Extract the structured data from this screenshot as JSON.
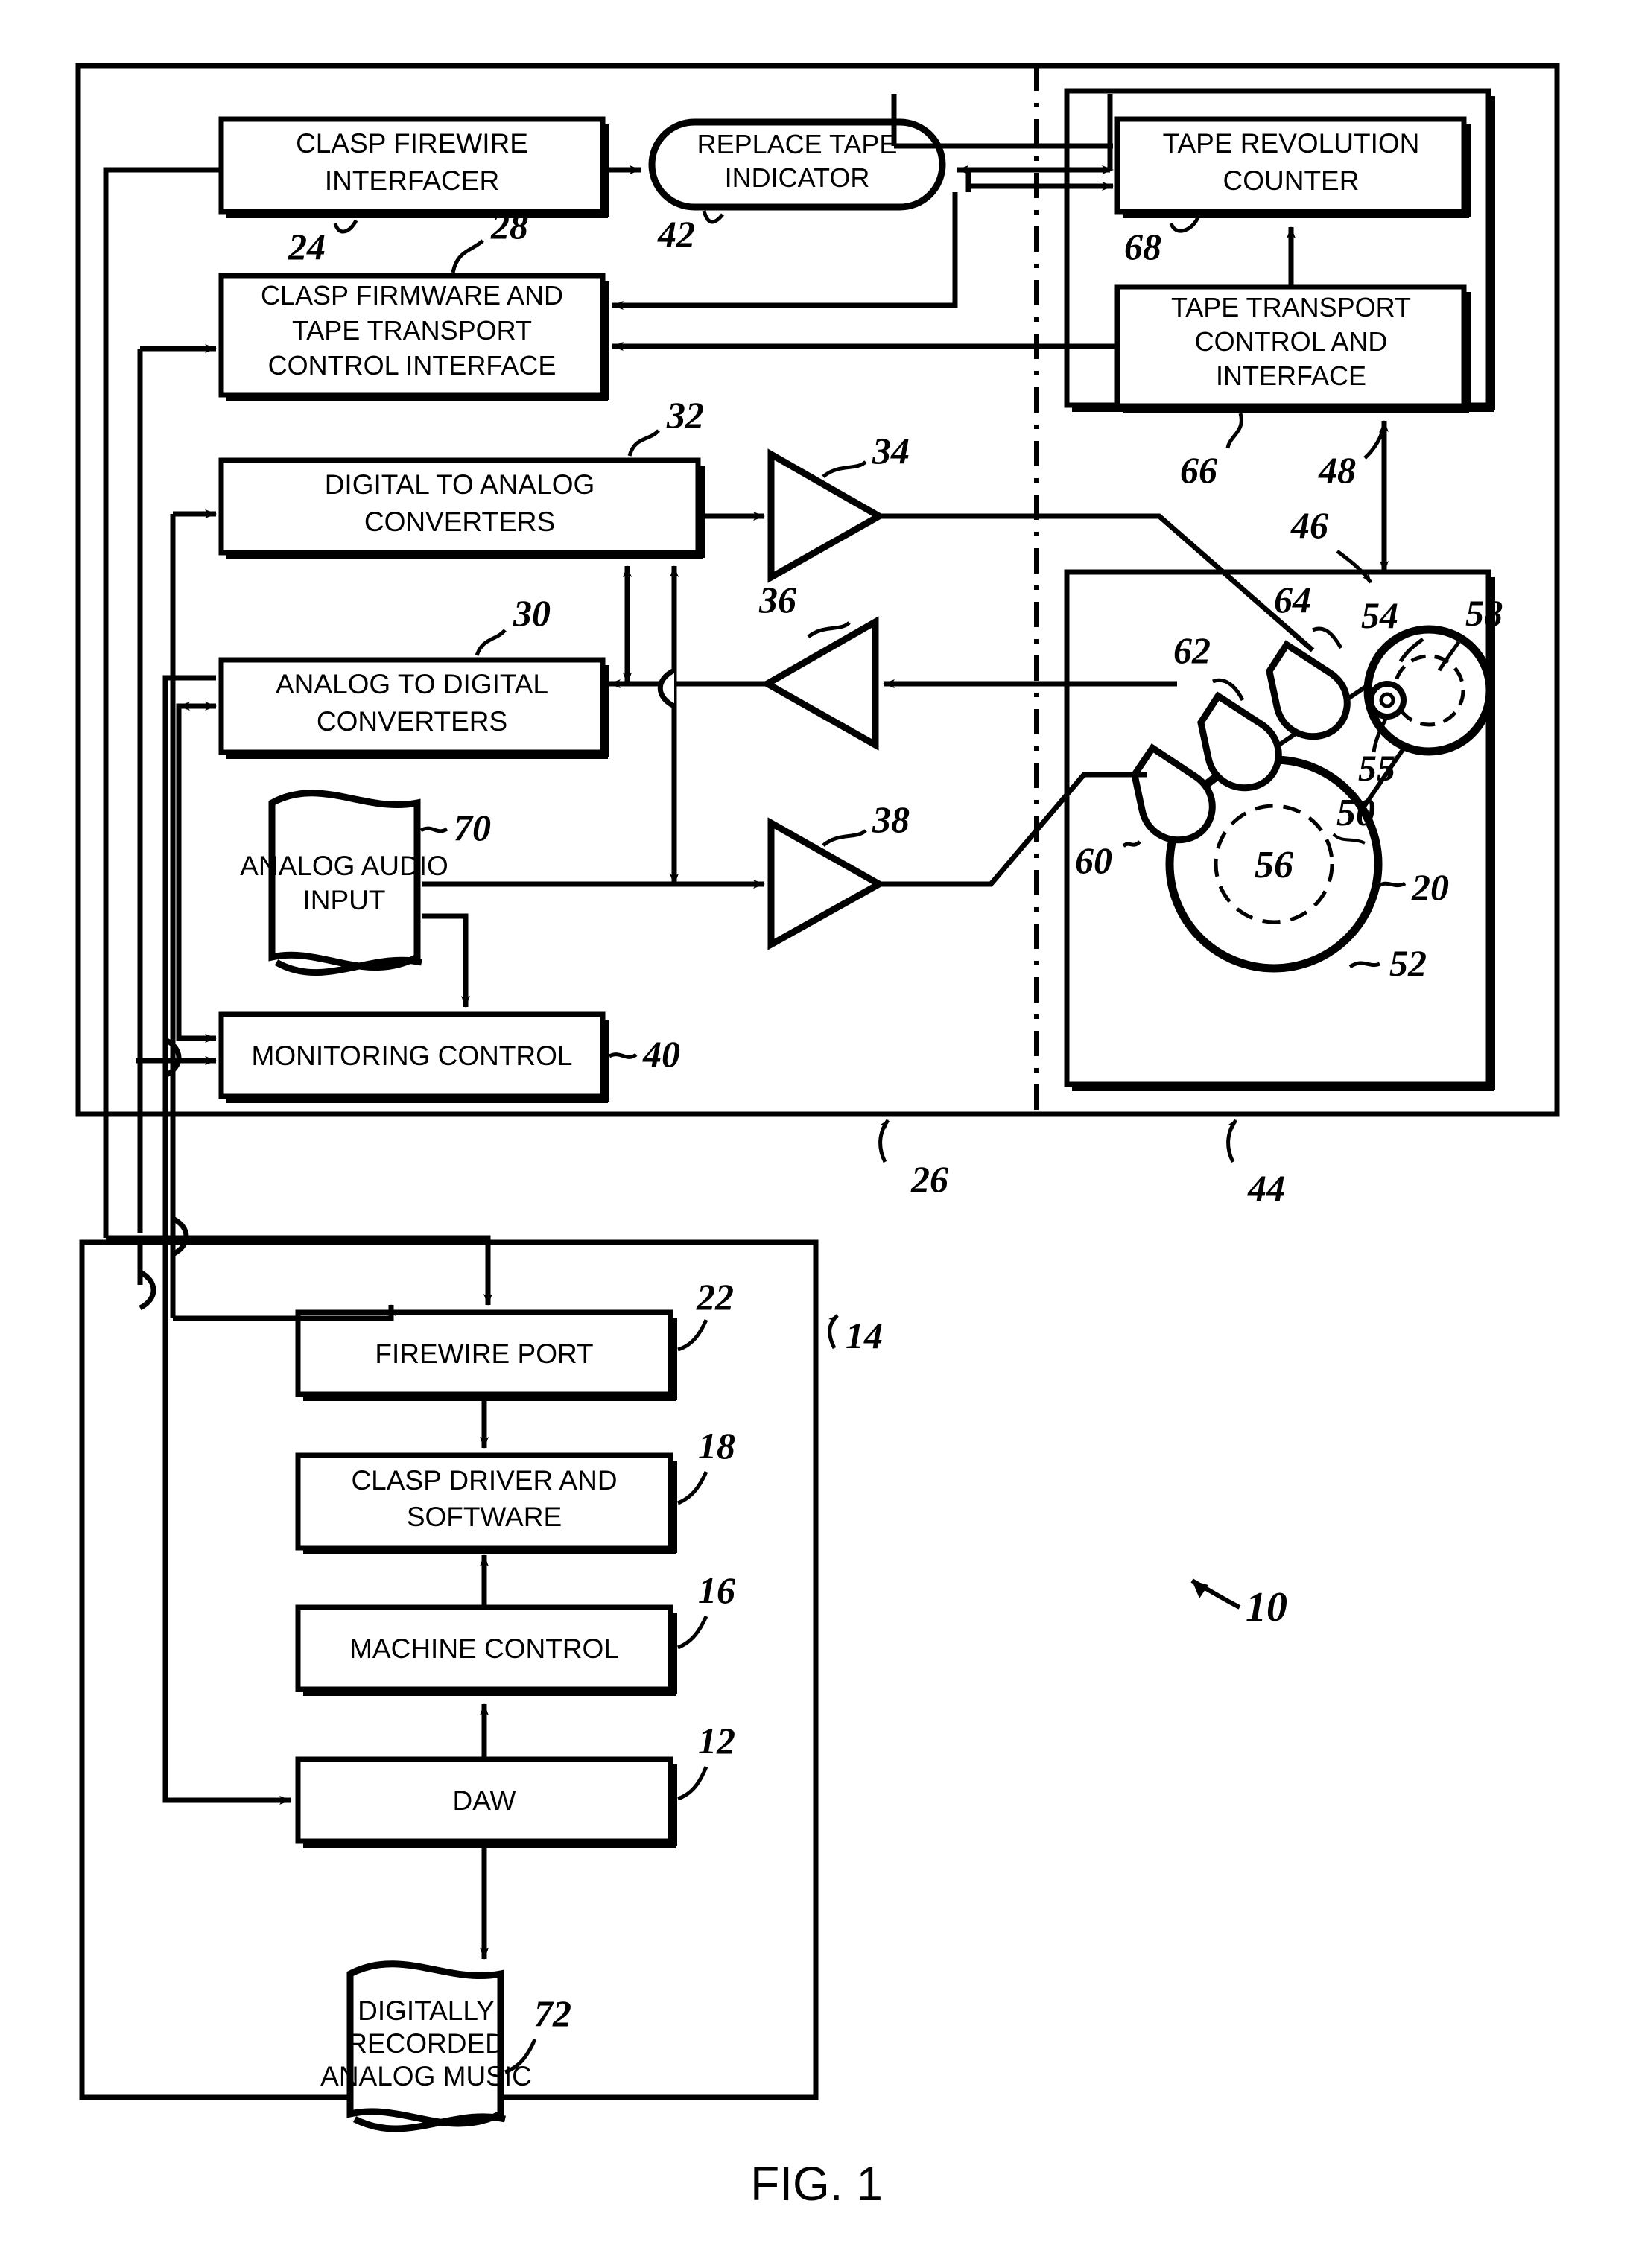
{
  "figure": {
    "caption": "FIG. 1",
    "title_number": "10"
  },
  "blocks": {
    "clasp_firewire_interfacer": {
      "lines": [
        "CLASP  FIREWIRE",
        "INTERFACER"
      ],
      "ref": "24"
    },
    "clasp_firmware_tape_transport": {
      "lines": [
        "CLASP FIRMWARE AND",
        "TAPE TRANSPORT",
        "CONTROL INTERFACE"
      ],
      "ref": "28"
    },
    "replace_tape_indicator": {
      "lines": [
        "REPLACE TAPE",
        "INDICATOR"
      ],
      "ref": "42"
    },
    "tape_revolution_counter": {
      "lines": [
        "TAPE REVOLUTION",
        "COUNTER"
      ],
      "ref": "68"
    },
    "tape_transport_control_interface": {
      "lines": [
        "TAPE TRANSPORT",
        "CONTROL AND",
        "INTERFACE"
      ],
      "ref": "66"
    },
    "digital_to_analog_converters": {
      "lines": [
        "DIGITAL TO ANALOG",
        "CONVERTERS"
      ],
      "ref": "32"
    },
    "analog_to_digital_converters": {
      "lines": [
        "ANALOG TO DIGITAL",
        "CONVERTERS"
      ],
      "ref": "30"
    },
    "analog_audio_input": {
      "lines": [
        "ANALOG AUDIO",
        "INPUT"
      ],
      "ref": "70"
    },
    "monitoring_control": {
      "lines": [
        "MONITORING CONTROL"
      ],
      "ref": "40"
    },
    "firewire_port": {
      "lines": [
        "FIREWIRE PORT"
      ],
      "ref": "22"
    },
    "clasp_driver_and_software": {
      "lines": [
        "CLASP DRIVER AND",
        "SOFTWARE"
      ],
      "ref": "18"
    },
    "machine_control": {
      "lines": [
        "MACHINE CONTROL"
      ],
      "ref": "16"
    },
    "daw": {
      "lines": [
        "DAW"
      ],
      "ref": "12"
    },
    "digitally_recorded_analog_music": {
      "lines": [
        "DIGITALLY",
        "RECORDED",
        "ANALOG MUSIC"
      ],
      "ref": "72"
    }
  },
  "amplifiers": [
    {
      "ref": "34",
      "direction": "right"
    },
    {
      "ref": "36",
      "direction": "left"
    },
    {
      "ref": "38",
      "direction": "right"
    }
  ],
  "enclosures": {
    "recorder_enclosure_ref": "26",
    "transport_enclosure_ref": "44",
    "computer_enclosure_ref": "14",
    "transport_assembly_ref": "46",
    "transport_link_ref": "48"
  },
  "transport_parts": {
    "tape_ref": "20",
    "tape_path_ref": "50",
    "supply_reel_ref": "52",
    "capstan_ref": "54",
    "tach_roller_ref": "55",
    "supply_hub_ref": "56",
    "takeup_reel_ref": "58",
    "erase_head_ref": "60",
    "record_head_ref": "62",
    "playback_head_ref": "64"
  }
}
